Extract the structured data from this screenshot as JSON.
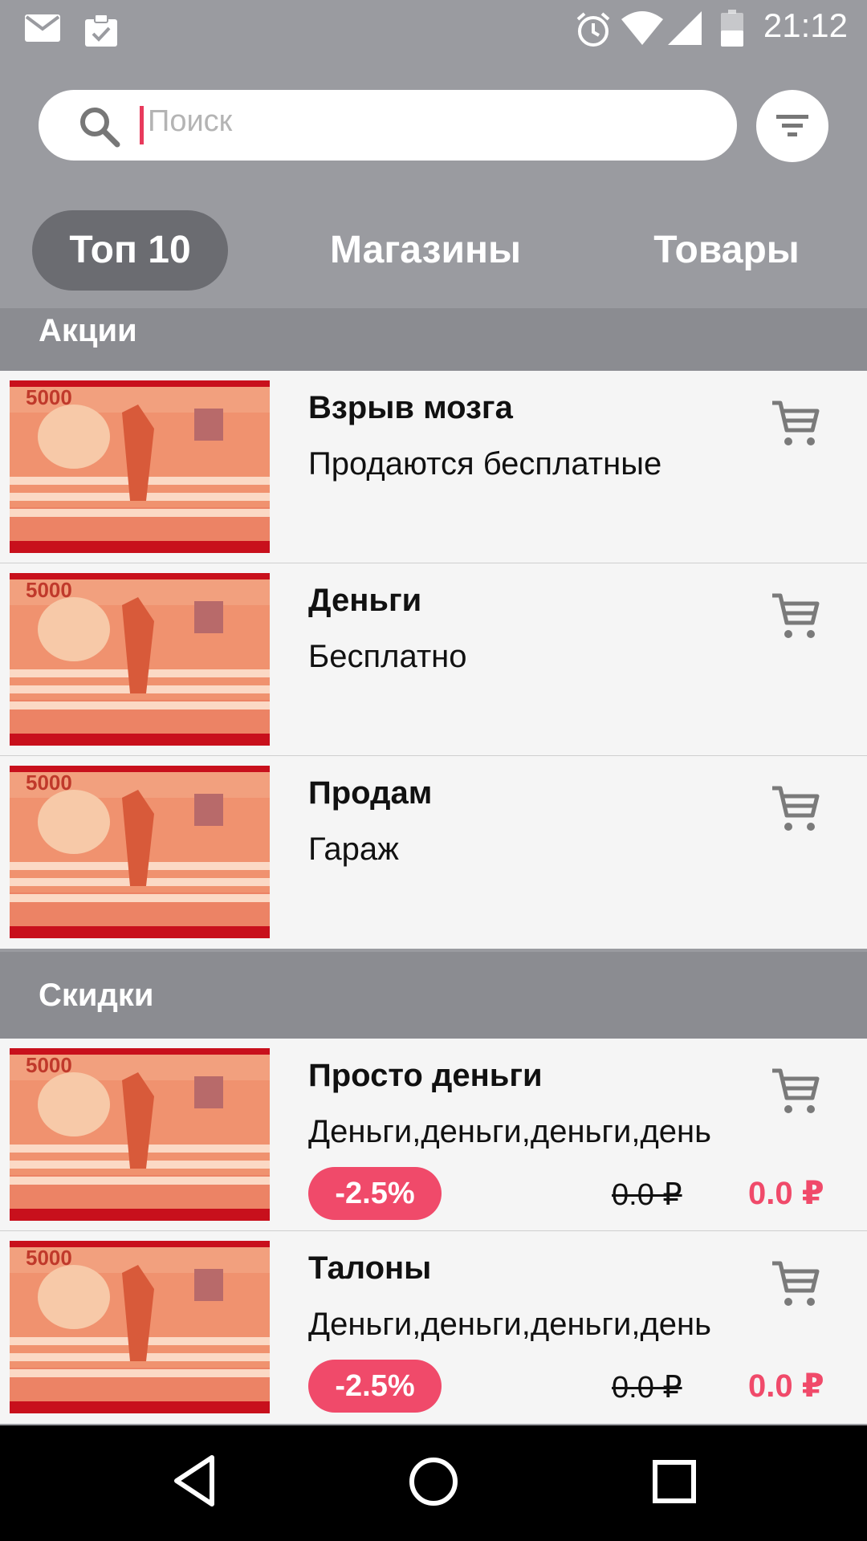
{
  "status_bar": {
    "time": "21:12",
    "icons": [
      "mail-icon",
      "clipboard-check-icon",
      "alarm-icon",
      "wifi-icon",
      "signal-icon",
      "battery-icon"
    ]
  },
  "search": {
    "placeholder": "Поиск"
  },
  "tabs": [
    {
      "label": "Топ 10",
      "active": true
    },
    {
      "label": "Магазины",
      "active": false
    },
    {
      "label": "Товары",
      "active": false
    }
  ],
  "sections": {
    "akcii": {
      "title": "Акции",
      "items": [
        {
          "title": "Взрыв мозга",
          "description": "Продаются бесплатные"
        },
        {
          "title": "Деньги",
          "description": "Бесплатно"
        },
        {
          "title": "Продам",
          "description": "Гараж"
        }
      ]
    },
    "skidki": {
      "title": "Скидки",
      "items": [
        {
          "title": "Просто деньги",
          "description": "Деньги,деньги,деньги,день",
          "discount": "-2.5%",
          "old_price": "0.0 ₽",
          "new_price": "0.0 ₽"
        },
        {
          "title": "Талоны",
          "description": "Деньги,деньги,деньги,день",
          "discount": "-2.5%",
          "old_price": "0.0 ₽",
          "new_price": "0.0 ₽"
        }
      ]
    }
  },
  "colors": {
    "background": "#9a9ba0",
    "section_header": "#8b8c91",
    "active_tab": "#6b6c71",
    "accent": "#f04a6a",
    "list_background": "#f5f5f5"
  },
  "nav_bar": {
    "icons": [
      "back-icon",
      "home-icon",
      "recents-icon"
    ]
  }
}
